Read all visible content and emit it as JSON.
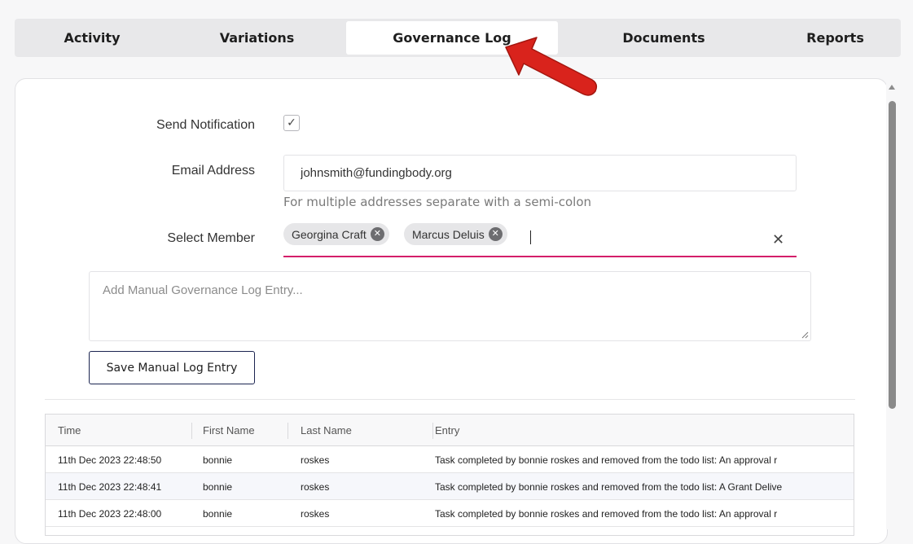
{
  "tabs": [
    {
      "label": "Activity",
      "active": false
    },
    {
      "label": "Variations",
      "active": false
    },
    {
      "label": "Governance Log",
      "active": true
    },
    {
      "label": "Documents",
      "active": false
    },
    {
      "label": "Reports",
      "active": false
    }
  ],
  "form": {
    "send_notification_label": "Send Notification",
    "send_notification_checked": true,
    "check_glyph": "✓",
    "email_label": "Email Address",
    "email_value": "johnsmith@fundingbody.org",
    "email_hint": "For multiple addresses separate with a semi-colon",
    "member_label": "Select Member",
    "members": [
      "Georgina Craft",
      "Marcus Deluis"
    ],
    "chip_remove_glyph": "✕",
    "clear_glyph": "✕",
    "manual_entry_placeholder": "Add Manual Governance Log Entry...",
    "save_button_label": "Save Manual Log Entry"
  },
  "table": {
    "columns": [
      "Time",
      "First Name",
      "Last Name",
      "Entry"
    ],
    "rows": [
      [
        "11th Dec 2023 22:48:50",
        "bonnie",
        "roskes",
        "Task completed by bonnie roskes and removed from the todo list: An approval r"
      ],
      [
        "11th Dec 2023 22:48:41",
        "bonnie",
        "roskes",
        "Task completed by bonnie roskes and removed from the todo list: A Grant Delive"
      ],
      [
        "11th Dec 2023 22:48:00",
        "bonnie",
        "roskes",
        "Task completed by bonnie roskes and removed from the todo list: An approval r"
      ]
    ]
  },
  "colors": {
    "accent_underline": "#d41e6a",
    "arrow_red": "#d9231c",
    "button_border": "#1b2450"
  }
}
